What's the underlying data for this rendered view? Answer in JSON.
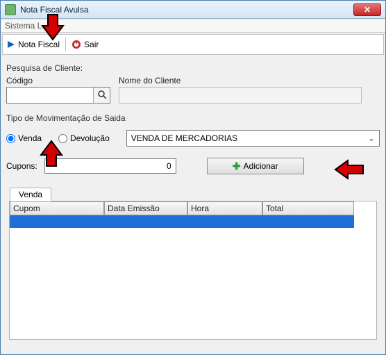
{
  "window": {
    "title": "Nota Fiscal Avulsa"
  },
  "menubar": {
    "label": "Sistema L..."
  },
  "toolbar": {
    "notafiscal_label": "Nota Fiscal",
    "sair_label": "Sair"
  },
  "pesquisa": {
    "section_label": "Pesquisa de Cliente:",
    "codigo_label": "Código",
    "codigo_value": "",
    "nome_label": "Nome do Cliente",
    "nome_value": ""
  },
  "movimentacao": {
    "section_label": "Tipo de Movimentação de Saida",
    "venda_label": "Venda",
    "devolucao_label": "Devolução",
    "selected_value": "VENDA DE MERCADORIAS"
  },
  "cupons": {
    "label": "Cupons:",
    "value": "0",
    "add_label": "Adicionar"
  },
  "tabs": {
    "venda_label": "Venda"
  },
  "grid": {
    "columns": [
      "Cupom",
      "Data Emissão",
      "Hora",
      "Total"
    ],
    "rows": [
      {
        "cupom": "",
        "data": "",
        "hora": "",
        "total": ""
      }
    ]
  }
}
